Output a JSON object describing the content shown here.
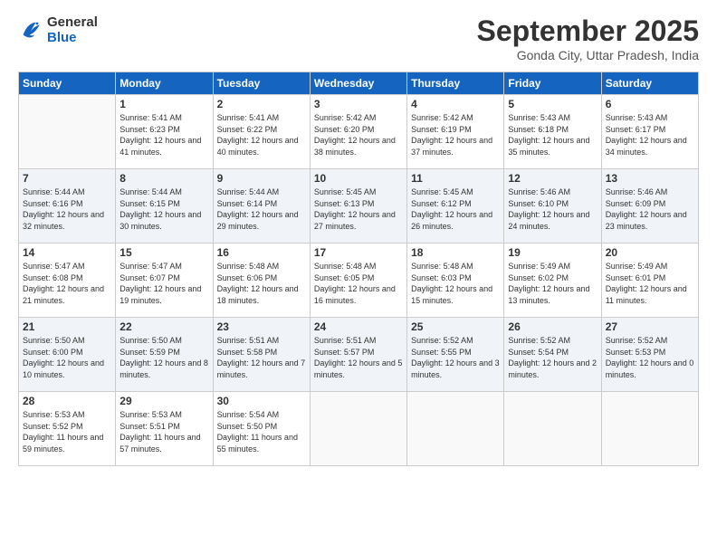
{
  "logo": {
    "line1": "General",
    "line2": "Blue"
  },
  "header": {
    "month": "September 2025",
    "location": "Gonda City, Uttar Pradesh, India"
  },
  "weekdays": [
    "Sunday",
    "Monday",
    "Tuesday",
    "Wednesday",
    "Thursday",
    "Friday",
    "Saturday"
  ],
  "weeks": [
    [
      {
        "day": "",
        "sunrise": "",
        "sunset": "",
        "daylight": ""
      },
      {
        "day": "1",
        "sunrise": "Sunrise: 5:41 AM",
        "sunset": "Sunset: 6:23 PM",
        "daylight": "Daylight: 12 hours and 41 minutes."
      },
      {
        "day": "2",
        "sunrise": "Sunrise: 5:41 AM",
        "sunset": "Sunset: 6:22 PM",
        "daylight": "Daylight: 12 hours and 40 minutes."
      },
      {
        "day": "3",
        "sunrise": "Sunrise: 5:42 AM",
        "sunset": "Sunset: 6:20 PM",
        "daylight": "Daylight: 12 hours and 38 minutes."
      },
      {
        "day": "4",
        "sunrise": "Sunrise: 5:42 AM",
        "sunset": "Sunset: 6:19 PM",
        "daylight": "Daylight: 12 hours and 37 minutes."
      },
      {
        "day": "5",
        "sunrise": "Sunrise: 5:43 AM",
        "sunset": "Sunset: 6:18 PM",
        "daylight": "Daylight: 12 hours and 35 minutes."
      },
      {
        "day": "6",
        "sunrise": "Sunrise: 5:43 AM",
        "sunset": "Sunset: 6:17 PM",
        "daylight": "Daylight: 12 hours and 34 minutes."
      }
    ],
    [
      {
        "day": "7",
        "sunrise": "Sunrise: 5:44 AM",
        "sunset": "Sunset: 6:16 PM",
        "daylight": "Daylight: 12 hours and 32 minutes."
      },
      {
        "day": "8",
        "sunrise": "Sunrise: 5:44 AM",
        "sunset": "Sunset: 6:15 PM",
        "daylight": "Daylight: 12 hours and 30 minutes."
      },
      {
        "day": "9",
        "sunrise": "Sunrise: 5:44 AM",
        "sunset": "Sunset: 6:14 PM",
        "daylight": "Daylight: 12 hours and 29 minutes."
      },
      {
        "day": "10",
        "sunrise": "Sunrise: 5:45 AM",
        "sunset": "Sunset: 6:13 PM",
        "daylight": "Daylight: 12 hours and 27 minutes."
      },
      {
        "day": "11",
        "sunrise": "Sunrise: 5:45 AM",
        "sunset": "Sunset: 6:12 PM",
        "daylight": "Daylight: 12 hours and 26 minutes."
      },
      {
        "day": "12",
        "sunrise": "Sunrise: 5:46 AM",
        "sunset": "Sunset: 6:10 PM",
        "daylight": "Daylight: 12 hours and 24 minutes."
      },
      {
        "day": "13",
        "sunrise": "Sunrise: 5:46 AM",
        "sunset": "Sunset: 6:09 PM",
        "daylight": "Daylight: 12 hours and 23 minutes."
      }
    ],
    [
      {
        "day": "14",
        "sunrise": "Sunrise: 5:47 AM",
        "sunset": "Sunset: 6:08 PM",
        "daylight": "Daylight: 12 hours and 21 minutes."
      },
      {
        "day": "15",
        "sunrise": "Sunrise: 5:47 AM",
        "sunset": "Sunset: 6:07 PM",
        "daylight": "Daylight: 12 hours and 19 minutes."
      },
      {
        "day": "16",
        "sunrise": "Sunrise: 5:48 AM",
        "sunset": "Sunset: 6:06 PM",
        "daylight": "Daylight: 12 hours and 18 minutes."
      },
      {
        "day": "17",
        "sunrise": "Sunrise: 5:48 AM",
        "sunset": "Sunset: 6:05 PM",
        "daylight": "Daylight: 12 hours and 16 minutes."
      },
      {
        "day": "18",
        "sunrise": "Sunrise: 5:48 AM",
        "sunset": "Sunset: 6:03 PM",
        "daylight": "Daylight: 12 hours and 15 minutes."
      },
      {
        "day": "19",
        "sunrise": "Sunrise: 5:49 AM",
        "sunset": "Sunset: 6:02 PM",
        "daylight": "Daylight: 12 hours and 13 minutes."
      },
      {
        "day": "20",
        "sunrise": "Sunrise: 5:49 AM",
        "sunset": "Sunset: 6:01 PM",
        "daylight": "Daylight: 12 hours and 11 minutes."
      }
    ],
    [
      {
        "day": "21",
        "sunrise": "Sunrise: 5:50 AM",
        "sunset": "Sunset: 6:00 PM",
        "daylight": "Daylight: 12 hours and 10 minutes."
      },
      {
        "day": "22",
        "sunrise": "Sunrise: 5:50 AM",
        "sunset": "Sunset: 5:59 PM",
        "daylight": "Daylight: 12 hours and 8 minutes."
      },
      {
        "day": "23",
        "sunrise": "Sunrise: 5:51 AM",
        "sunset": "Sunset: 5:58 PM",
        "daylight": "Daylight: 12 hours and 7 minutes."
      },
      {
        "day": "24",
        "sunrise": "Sunrise: 5:51 AM",
        "sunset": "Sunset: 5:57 PM",
        "daylight": "Daylight: 12 hours and 5 minutes."
      },
      {
        "day": "25",
        "sunrise": "Sunrise: 5:52 AM",
        "sunset": "Sunset: 5:55 PM",
        "daylight": "Daylight: 12 hours and 3 minutes."
      },
      {
        "day": "26",
        "sunrise": "Sunrise: 5:52 AM",
        "sunset": "Sunset: 5:54 PM",
        "daylight": "Daylight: 12 hours and 2 minutes."
      },
      {
        "day": "27",
        "sunrise": "Sunrise: 5:52 AM",
        "sunset": "Sunset: 5:53 PM",
        "daylight": "Daylight: 12 hours and 0 minutes."
      }
    ],
    [
      {
        "day": "28",
        "sunrise": "Sunrise: 5:53 AM",
        "sunset": "Sunset: 5:52 PM",
        "daylight": "Daylight: 11 hours and 59 minutes."
      },
      {
        "day": "29",
        "sunrise": "Sunrise: 5:53 AM",
        "sunset": "Sunset: 5:51 PM",
        "daylight": "Daylight: 11 hours and 57 minutes."
      },
      {
        "day": "30",
        "sunrise": "Sunrise: 5:54 AM",
        "sunset": "Sunset: 5:50 PM",
        "daylight": "Daylight: 11 hours and 55 minutes."
      },
      {
        "day": "",
        "sunrise": "",
        "sunset": "",
        "daylight": ""
      },
      {
        "day": "",
        "sunrise": "",
        "sunset": "",
        "daylight": ""
      },
      {
        "day": "",
        "sunrise": "",
        "sunset": "",
        "daylight": ""
      },
      {
        "day": "",
        "sunrise": "",
        "sunset": "",
        "daylight": ""
      }
    ]
  ]
}
